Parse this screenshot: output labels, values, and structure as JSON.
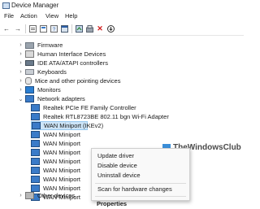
{
  "window": {
    "title": "Device Manager"
  },
  "menu": [
    "File",
    "Action",
    "View",
    "Help"
  ],
  "tree": {
    "categories_top": [
      {
        "label": "Firmware",
        "expanded": false
      },
      {
        "label": "Human Interface Devices",
        "expanded": false
      },
      {
        "label": "IDE ATA/ATAPI controllers",
        "expanded": false
      },
      {
        "label": "Keyboards",
        "expanded": false
      },
      {
        "label": "Mice and other pointing devices",
        "expanded": false
      },
      {
        "label": "Monitors",
        "expanded": false
      },
      {
        "label": "Network adapters",
        "expanded": true
      }
    ],
    "network_children": [
      "Realtek PCIe FE Family Controller",
      "Realtek RTL8723BE 802.11 bgn Wi-Fi Adapter",
      "WAN Miniport (IKEv2)",
      "WAN Miniport",
      "WAN Miniport",
      "WAN Miniport",
      "WAN Miniport",
      "WAN Miniport",
      "WAN Miniport",
      "WAN Miniport",
      "WAN Miniport"
    ],
    "selected_child": "WAN Miniport (IKEv2)",
    "categories_bottom": [
      {
        "label": "Other devices",
        "expanded": false
      }
    ]
  },
  "context_menu": {
    "items": [
      "Update driver",
      "Disable device",
      "Uninstall device",
      "Scan for hardware changes",
      "Properties"
    ],
    "highlighted": "Uninstall device"
  },
  "watermark": {
    "text": "TheWindowsClub"
  },
  "colors": {
    "selection": "#cce4f7",
    "accent": "#3a7bc8",
    "delete": "#d01a1a"
  }
}
